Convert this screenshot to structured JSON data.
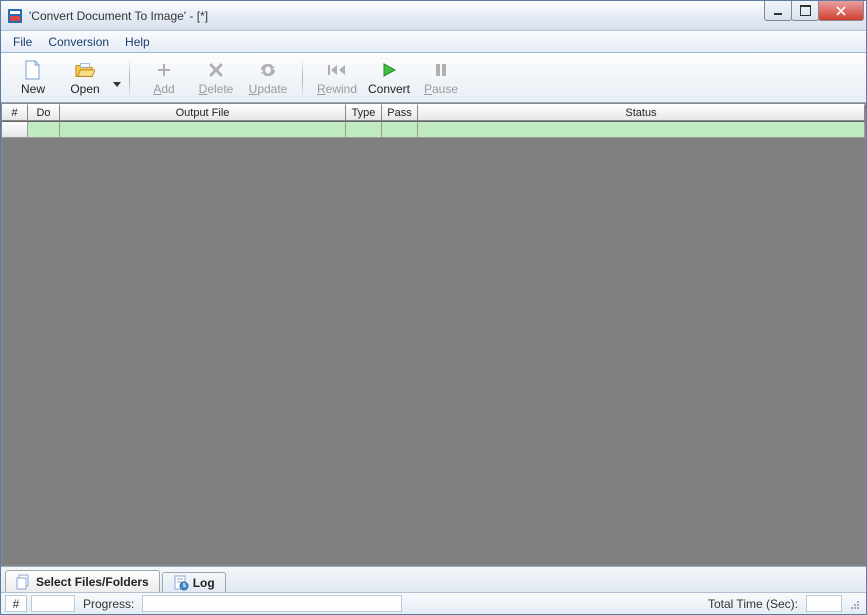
{
  "window": {
    "title": "'Convert Document To Image' - [*]"
  },
  "menu": {
    "items": [
      "File",
      "Conversion",
      "Help"
    ]
  },
  "toolbar": {
    "new": "New",
    "open": "Open",
    "add": "Add",
    "delete": "Delete",
    "update": "Update",
    "rewind": "Rewind",
    "convert": "Convert",
    "pause": "Pause"
  },
  "grid": {
    "headers": [
      "#",
      "Do",
      "Output File",
      "Type",
      "Pass",
      "Status"
    ]
  },
  "tabs": {
    "select": "Select Files/Folders",
    "log": "Log"
  },
  "status": {
    "hash": "#",
    "progress_label": "Progress:",
    "total_time_label": "Total Time (Sec):"
  }
}
